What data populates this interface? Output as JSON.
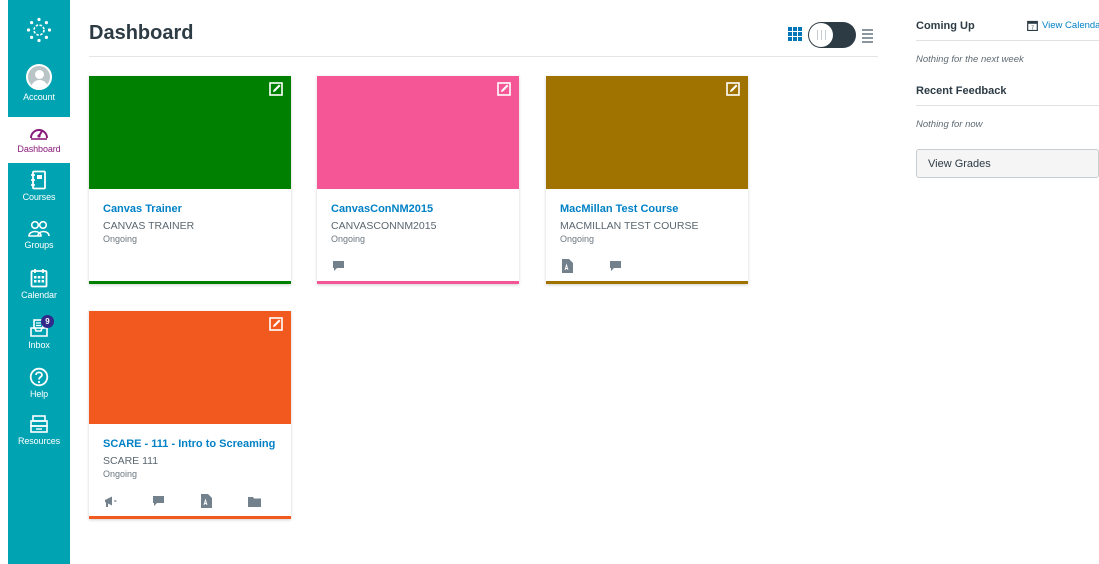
{
  "nav": {
    "account": "Account",
    "dashboard": "Dashboard",
    "courses": "Courses",
    "groups": "Groups",
    "calendar": "Calendar",
    "inbox": "Inbox",
    "inbox_count": "9",
    "help": "Help",
    "resources": "Resources"
  },
  "header": {
    "title": "Dashboard"
  },
  "cards": [
    {
      "title": "Canvas Trainer",
      "code": "CANVAS TRAINER",
      "term": "Ongoing",
      "color": "#008000"
    },
    {
      "title": "CanvasConNM2015",
      "code": "CANVASCONNM2015",
      "term": "Ongoing",
      "color": "#f55696"
    },
    {
      "title": "MacMillan Test Course",
      "code": "MACMILLAN TEST COURSE",
      "term": "Ongoing",
      "color": "#a07300"
    },
    {
      "title": "SCARE - 111 - Intro to Screaming",
      "code": "SCARE 111",
      "term": "Ongoing",
      "color": "#f2591e"
    }
  ],
  "sidebar": {
    "coming_up": "Coming Up",
    "view_calendar": "View Calendar",
    "coming_up_empty": "Nothing for the next week",
    "recent_feedback": "Recent Feedback",
    "feedback_empty": "Nothing for now",
    "view_grades": "View Grades"
  },
  "colors": {
    "nav": "#00a3b1",
    "link": "#0081c6",
    "active_nav": "#8a1b7a"
  }
}
